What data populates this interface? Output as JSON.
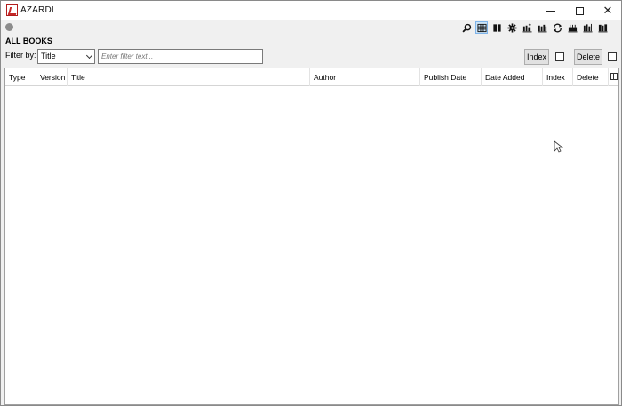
{
  "window": {
    "title": "AZARDI",
    "controls": {
      "minimize": "minimize",
      "maximize": "maximize",
      "close": "✕"
    }
  },
  "toolbar": {
    "icons": [
      {
        "name": "search-icon",
        "active": false
      },
      {
        "name": "list-view-icon",
        "active": true
      },
      {
        "name": "grid-view-icon",
        "active": false
      },
      {
        "name": "settings-gear-icon",
        "active": false
      },
      {
        "name": "add-book-icon",
        "active": false
      },
      {
        "name": "library-icon",
        "active": false
      },
      {
        "name": "sync-icon",
        "active": false
      },
      {
        "name": "collection-icon",
        "active": false
      },
      {
        "name": "import-icon",
        "active": false
      },
      {
        "name": "shelf-icon",
        "active": false
      }
    ]
  },
  "section": {
    "title": "ALL BOOKS"
  },
  "filter": {
    "label": "Filter by:",
    "selected": "Title",
    "placeholder": "Enter filter text..."
  },
  "actions": {
    "index_label": "Index",
    "delete_label": "Delete"
  },
  "table": {
    "columns": [
      "Type",
      "Version",
      "Title",
      "Author",
      "Publish Date",
      "Date Added",
      "Index",
      "Delete"
    ],
    "rows": []
  }
}
